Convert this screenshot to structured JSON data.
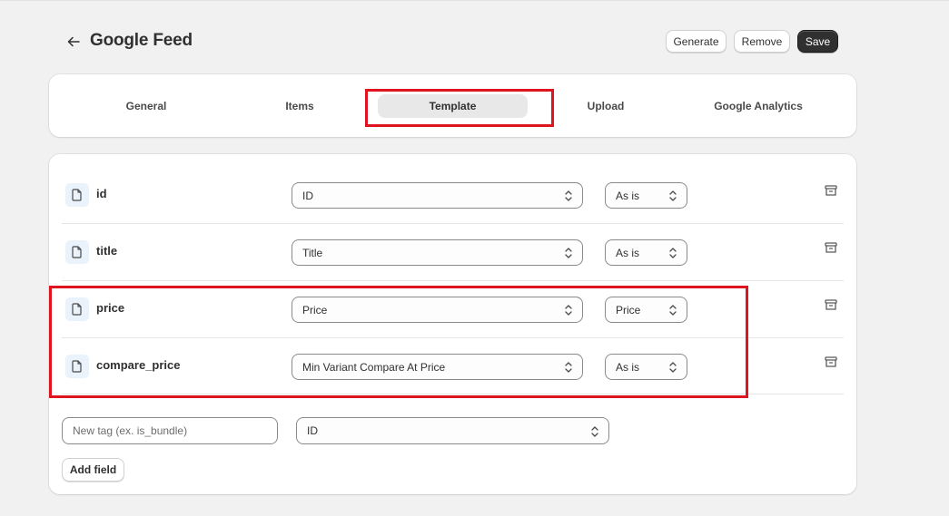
{
  "header": {
    "title": "Google Feed",
    "back_icon": "arrow-left-icon",
    "buttons": {
      "generate": "Generate",
      "remove": "Remove",
      "save": "Save"
    }
  },
  "tabs": [
    {
      "label": "General",
      "active": false
    },
    {
      "label": "Items",
      "active": false
    },
    {
      "label": "Template",
      "active": true
    },
    {
      "label": "Upload",
      "active": false
    },
    {
      "label": "Google Analytics",
      "active": false
    }
  ],
  "fields": [
    {
      "name": "id",
      "source": "ID",
      "modifier": "As is"
    },
    {
      "name": "title",
      "source": "Title",
      "modifier": "As is"
    },
    {
      "name": "price",
      "source": "Price",
      "modifier": "Price"
    },
    {
      "name": "compare_price",
      "source": "Min Variant Compare At Price",
      "modifier": "As is"
    }
  ],
  "new_field": {
    "placeholder": "New tag (ex. is_bundle)",
    "source": "ID",
    "add_label": "Add field"
  },
  "colors": {
    "highlight": "#e0141e",
    "primary_button": "#303030",
    "background": "#f1f1f1"
  }
}
